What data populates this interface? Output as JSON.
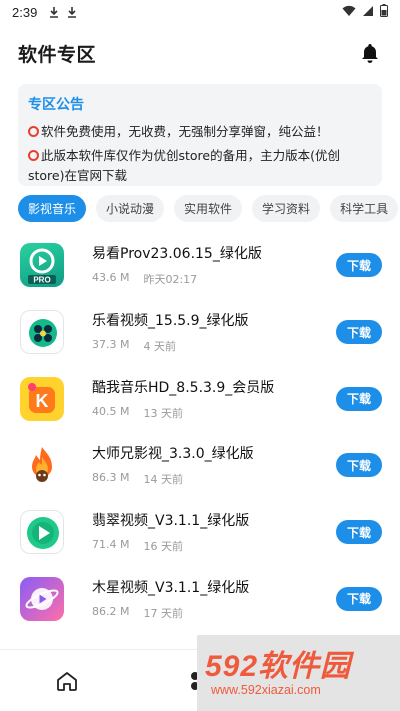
{
  "status_bar": {
    "time": "2:39"
  },
  "header": {
    "title": "软件专区"
  },
  "notice": {
    "title": "专区公告",
    "lines": [
      "软件免费使用，无收费，无强制分享弹窗，纯公益！",
      "此版本软件库仅作为优创store的备用，主力版本(优创store)在官网下载"
    ]
  },
  "tabs": [
    "影视音乐",
    "小说动漫",
    "实用软件",
    "学习资料",
    "科学工具"
  ],
  "apps": [
    {
      "name": "易看Prov23.06.15_绿化版",
      "size": "43.6 M",
      "time": "昨天02:17",
      "button": "下载",
      "icon": "yikan-icon"
    },
    {
      "name": "乐看视频_15.5.9_绿化版",
      "size": "37.3 M",
      "time": "4 天前",
      "button": "下载",
      "icon": "lekan-icon"
    },
    {
      "name": "酷我音乐HD_8.5.3.9_会员版",
      "size": "40.5 M",
      "time": "13 天前",
      "button": "下载",
      "icon": "kuwo-icon"
    },
    {
      "name": "大师兄影视_3.3.0_绿化版",
      "size": "86.3 M",
      "time": "14 天前",
      "button": "下载",
      "icon": "dashixiong-icon"
    },
    {
      "name": "翡翠视频_V3.1.1_绿化版",
      "size": "71.4 M",
      "time": "16 天前",
      "button": "下载",
      "icon": "feicui-icon"
    },
    {
      "name": "木星视频_V3.1.1_绿化版",
      "size": "86.2 M",
      "time": "17 天前",
      "button": "下载",
      "icon": "muxing-icon"
    }
  ],
  "watermark": {
    "logo": "592软件园",
    "url": "www.592xiazai.com"
  },
  "colors": {
    "accent": "#1e8fe8",
    "notice_bg": "#f3f4f6",
    "watermark_red": "#f05a3c"
  }
}
